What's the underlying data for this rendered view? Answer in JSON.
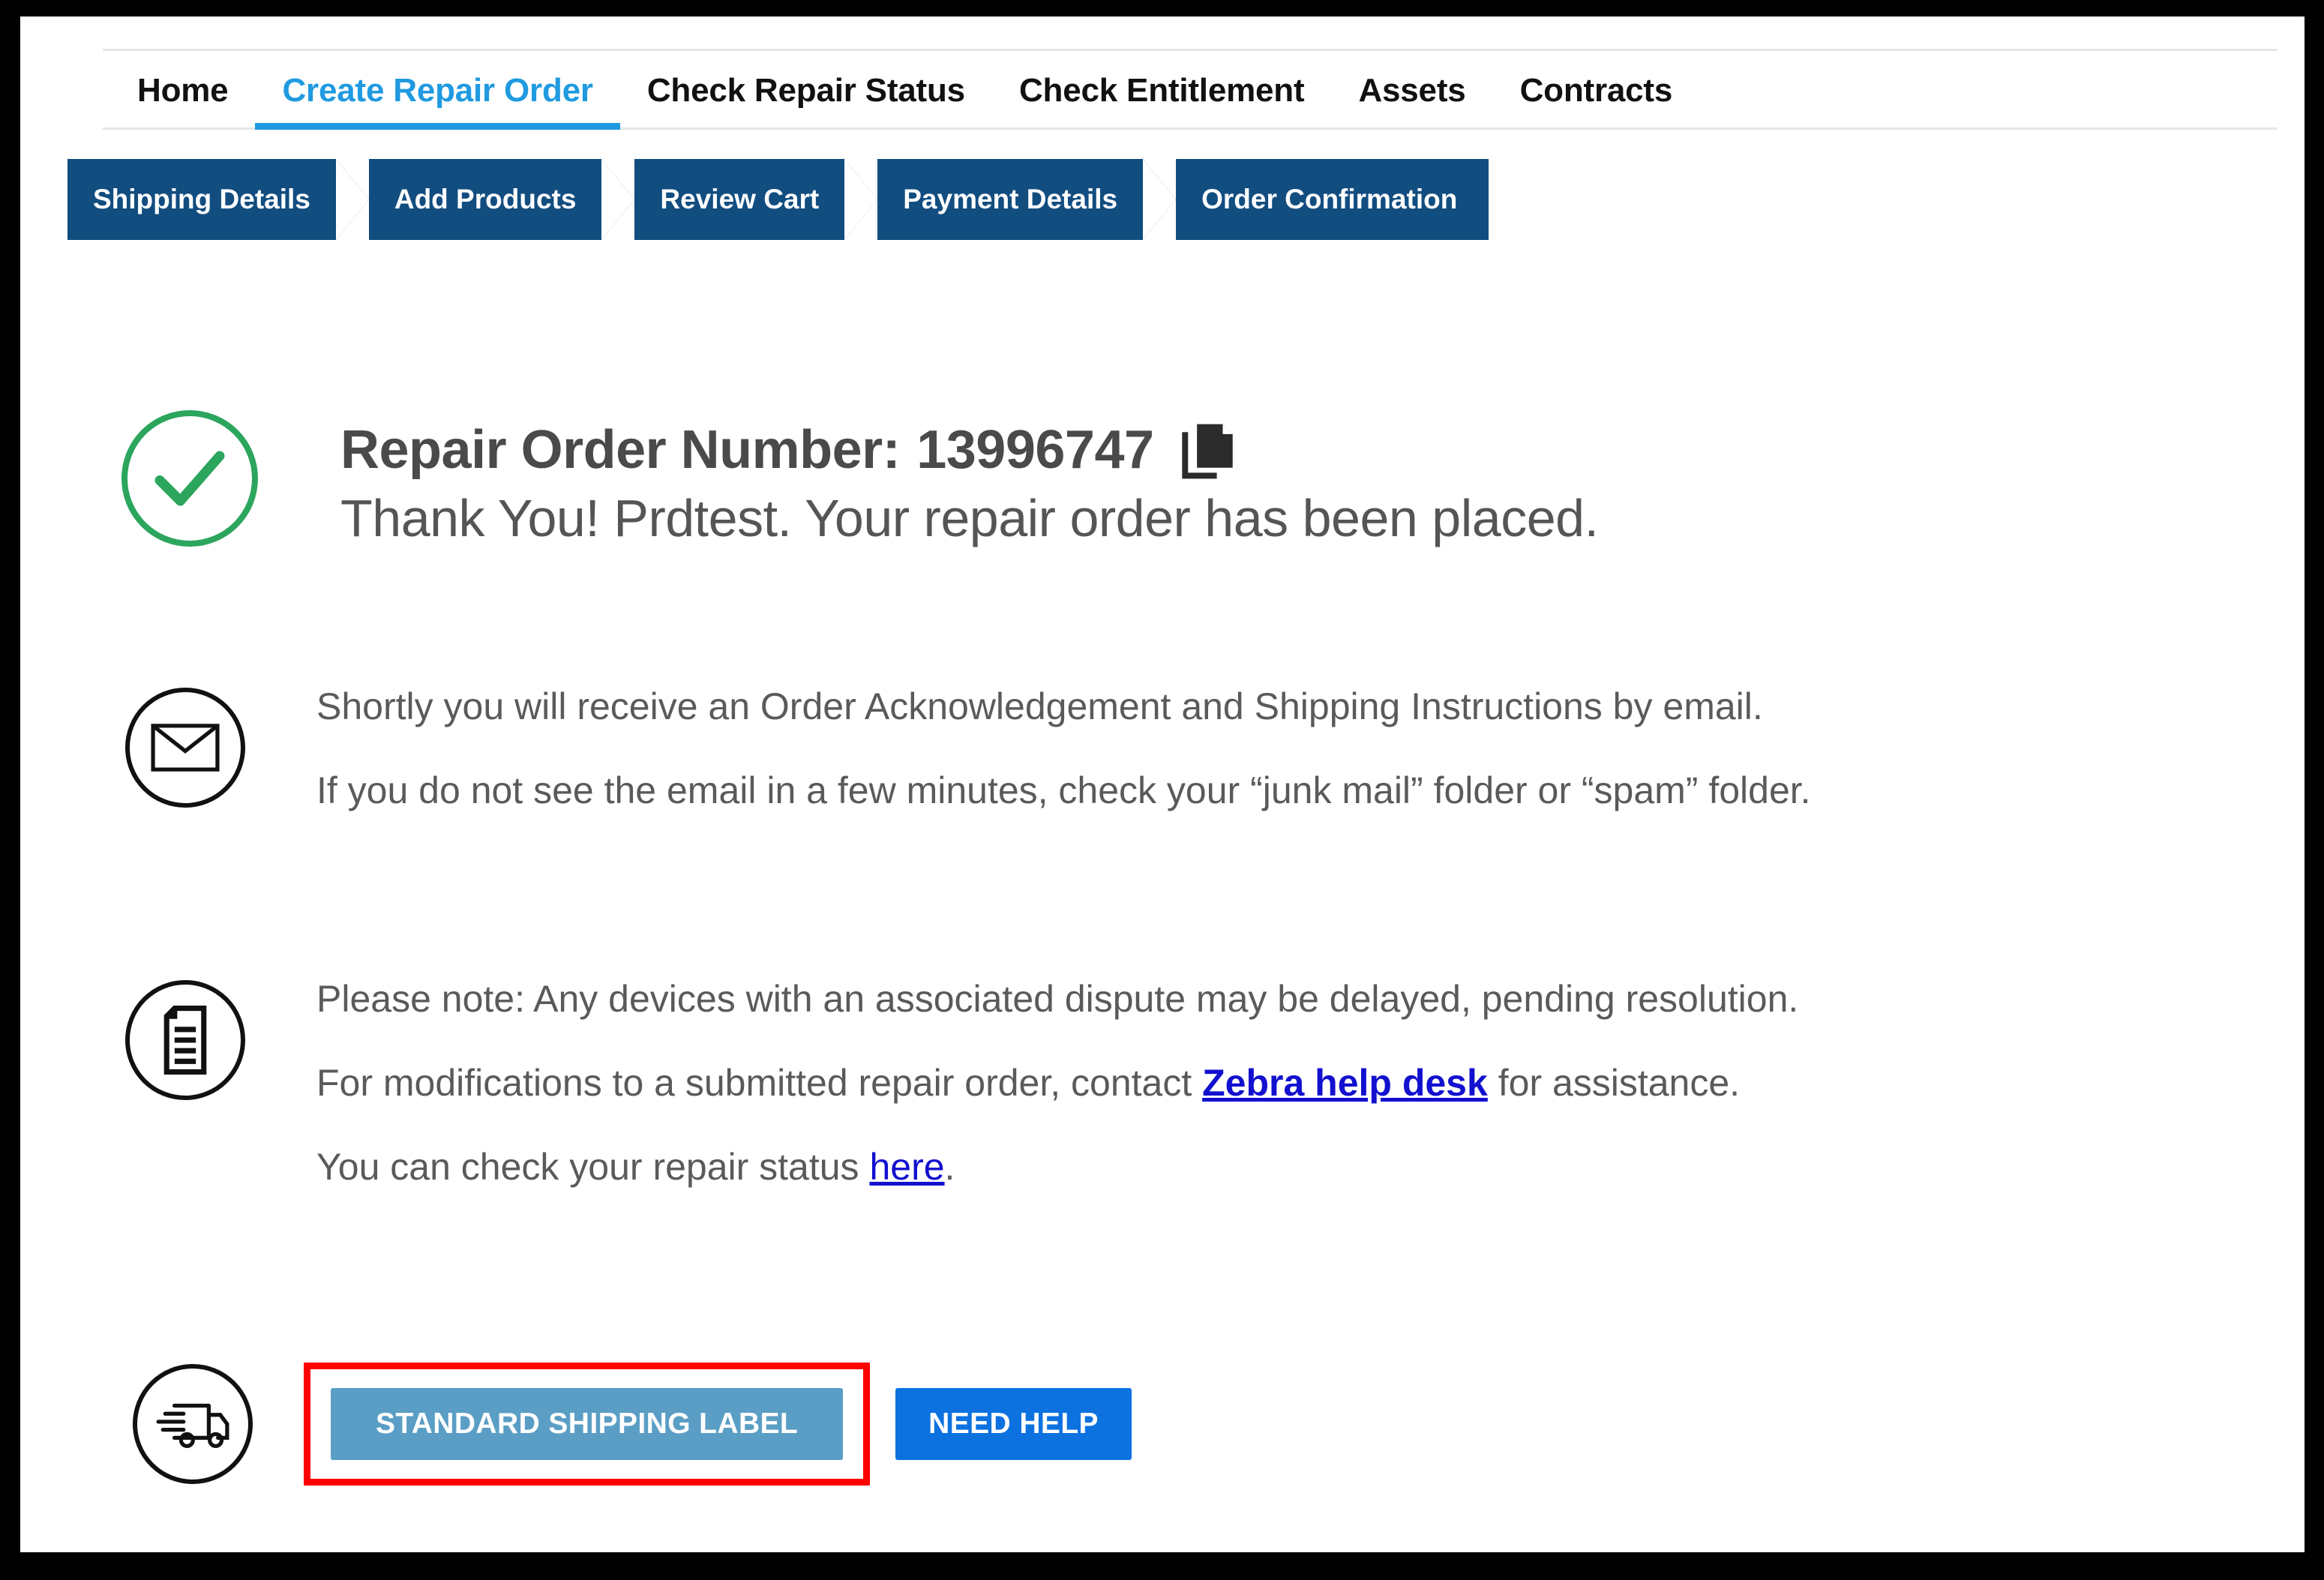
{
  "nav": {
    "tabs": [
      {
        "label": "Home",
        "active": false
      },
      {
        "label": "Create Repair Order",
        "active": true
      },
      {
        "label": "Check Repair Status",
        "active": false
      },
      {
        "label": "Check Entitlement",
        "active": false
      },
      {
        "label": "Assets",
        "active": false
      },
      {
        "label": "Contracts",
        "active": false
      }
    ],
    "active_color": "#1f9ae0",
    "inactive_color": "#111111"
  },
  "stepper": {
    "color": "#124d80",
    "steps": [
      {
        "label": "Shipping Details"
      },
      {
        "label": "Add Products"
      },
      {
        "label": "Review Cart"
      },
      {
        "label": "Payment Details"
      },
      {
        "label": "Order Confirmation"
      }
    ]
  },
  "confirmation": {
    "success_icon": "check-circle-icon",
    "success_color": "#2ca55d",
    "order_number_label": "Repair Order Number:",
    "order_number": "13996747",
    "copy_icon": "copy-document-icon",
    "thank_you_line": "Thank You! Prdtest. Your repair order has been placed."
  },
  "email_section": {
    "icon": "envelope-icon",
    "line1": "Shortly you will receive an Order Acknowledgement and Shipping Instructions by email.",
    "line2": "If you do not see the email in a few minutes, check your “junk mail” folder or “spam” folder."
  },
  "note_section": {
    "icon": "document-lines-icon",
    "line1": "Please note: Any devices with an associated dispute may be delayed, pending resolution.",
    "line2_before": "For modifications to a submitted repair order, contact ",
    "line2_link": " Zebra help desk",
    "line2_after": " for assistance.",
    "line3_before": "You can check your repair status ",
    "line3_link": "here",
    "line3_after": ".",
    "link_color": "#1210cf"
  },
  "actions": {
    "icon": "delivery-truck-icon",
    "standard_shipping_label": "STANDARD SHIPPING LABEL",
    "standard_shipping_color": "#5b9ec5",
    "need_help_label": "NEED HELP",
    "need_help_color": "#0d72e0",
    "highlight_color": "#ff0000"
  }
}
